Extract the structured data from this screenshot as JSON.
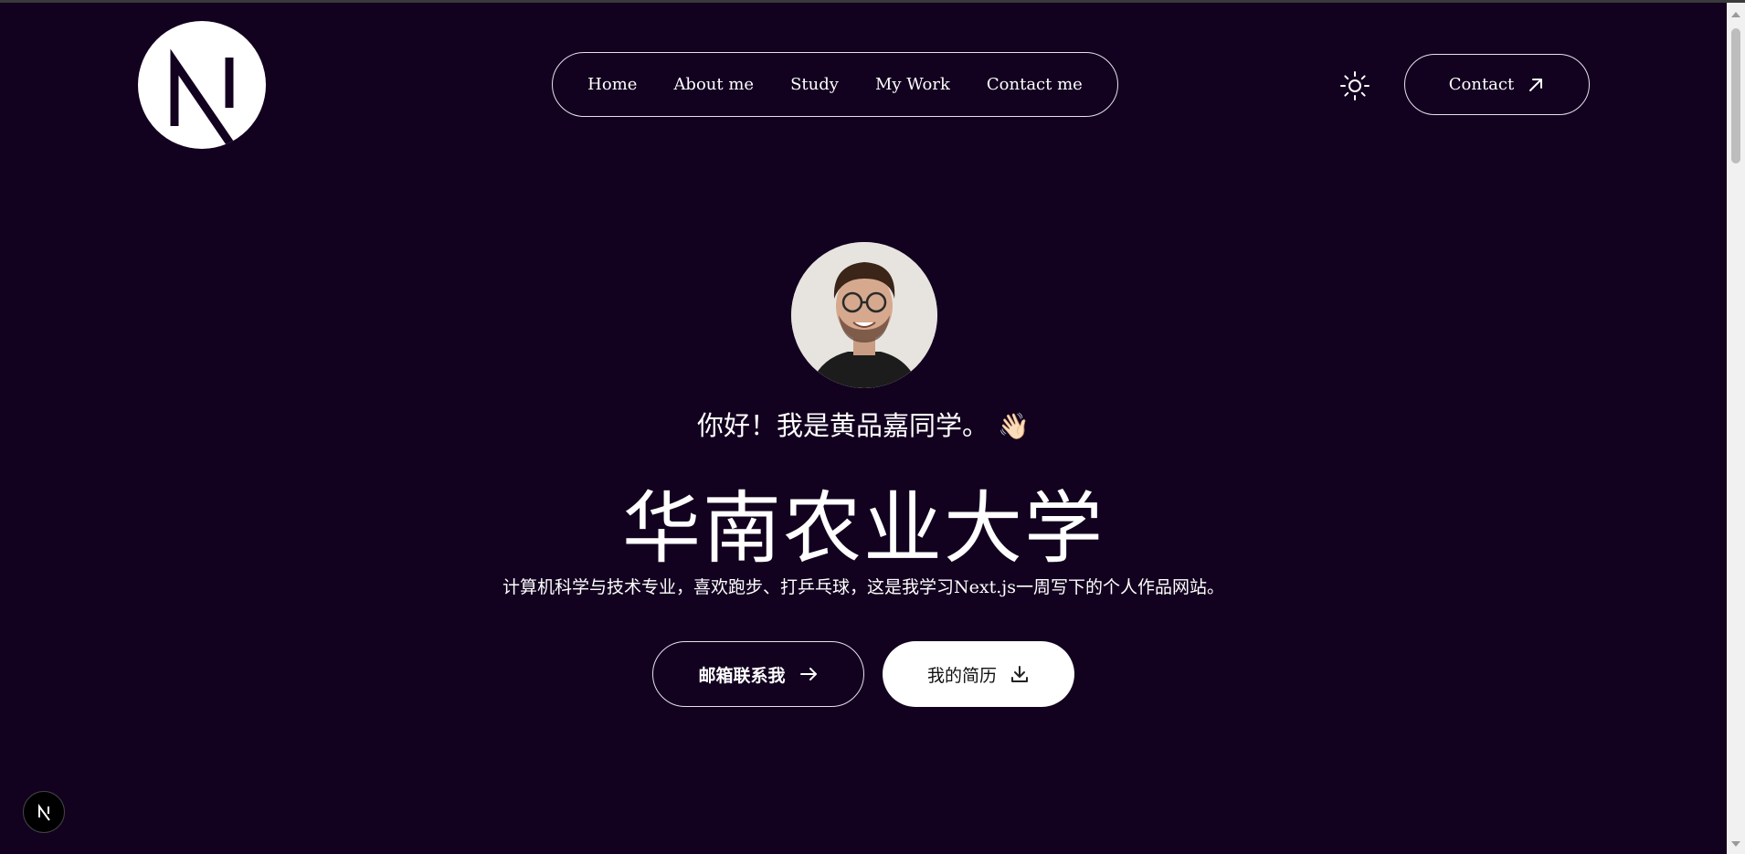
{
  "header": {
    "logo_icon": "nextjs-logo-icon",
    "nav": [
      "Home",
      "About me",
      "Study",
      "My Work",
      "Contact me"
    ],
    "theme_icon": "sun-icon",
    "contact_label": "Contact",
    "contact_icon": "arrow-up-right-icon"
  },
  "hero": {
    "avatar": "profile-photo",
    "greeting": "你好！我是黄品嘉同学。",
    "wave_emoji": "👋🏻",
    "title": "华南农业大学",
    "subtitle": "计算机科学与技术专业，喜欢跑步、打乒乓球，这是我学习Next.js一周写下的个人作品网站。",
    "email_button": "邮箱联系我",
    "email_icon": "arrow-right-icon",
    "resume_button": "我的简历",
    "resume_icon": "download-icon"
  },
  "dev_badge": "nextjs-badge-icon",
  "colors": {
    "background": "#12011f",
    "foreground": "#ffffff",
    "border": "#e8e0f0"
  }
}
